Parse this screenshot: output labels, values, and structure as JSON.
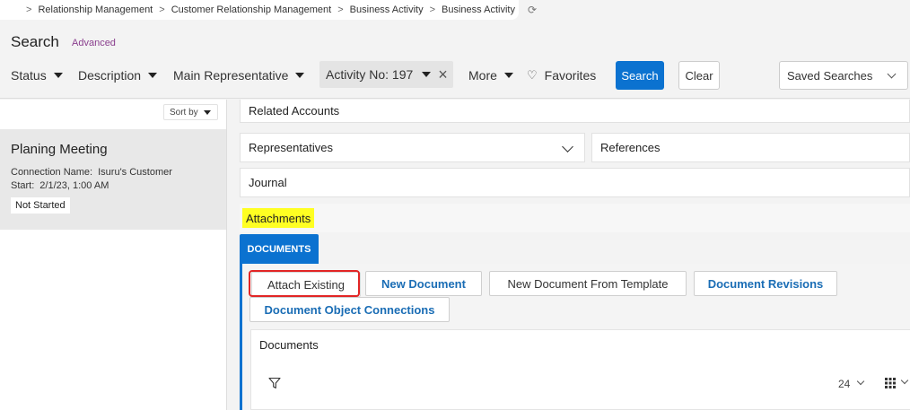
{
  "breadcrumb": {
    "items": [
      "Relationship Management",
      "Customer Relationship Management",
      "Business Activity",
      "Business Activity"
    ]
  },
  "header": {
    "title": "Search",
    "advanced_label": "Advanced"
  },
  "filters": {
    "status": "Status",
    "description": "Description",
    "main_representative": "Main Representative",
    "active_chip": "Activity No: 197",
    "more": "More",
    "favorites": "Favorites",
    "search_button": "Search",
    "clear_button": "Clear",
    "saved_searches": "Saved Searches"
  },
  "list": {
    "sort_label": "Sort by",
    "card": {
      "title": "Planing Meeting",
      "connection_label": "Connection Name:",
      "connection_value": "Isuru's Customer",
      "start_label": "Start:",
      "start_value": "2/1/23, 1:00 AM",
      "status": "Not Started"
    }
  },
  "detail": {
    "related_accounts": "Related Accounts",
    "representatives": "Representatives",
    "references": "References",
    "journal": "Journal",
    "attachments": "Attachments",
    "tab_documents": "DOCUMENTS",
    "buttons": {
      "attach_existing": "Attach Existing",
      "new_document": "New Document",
      "new_from_template": "New Document From Template",
      "document_revisions": "Document Revisions",
      "document_object_connections": "Document Object Connections"
    },
    "grid": {
      "title": "Documents",
      "page_size": "24"
    }
  },
  "colors": {
    "accent": "#0b72d0",
    "highlight": "#ffff22",
    "ring": "#e22525"
  }
}
